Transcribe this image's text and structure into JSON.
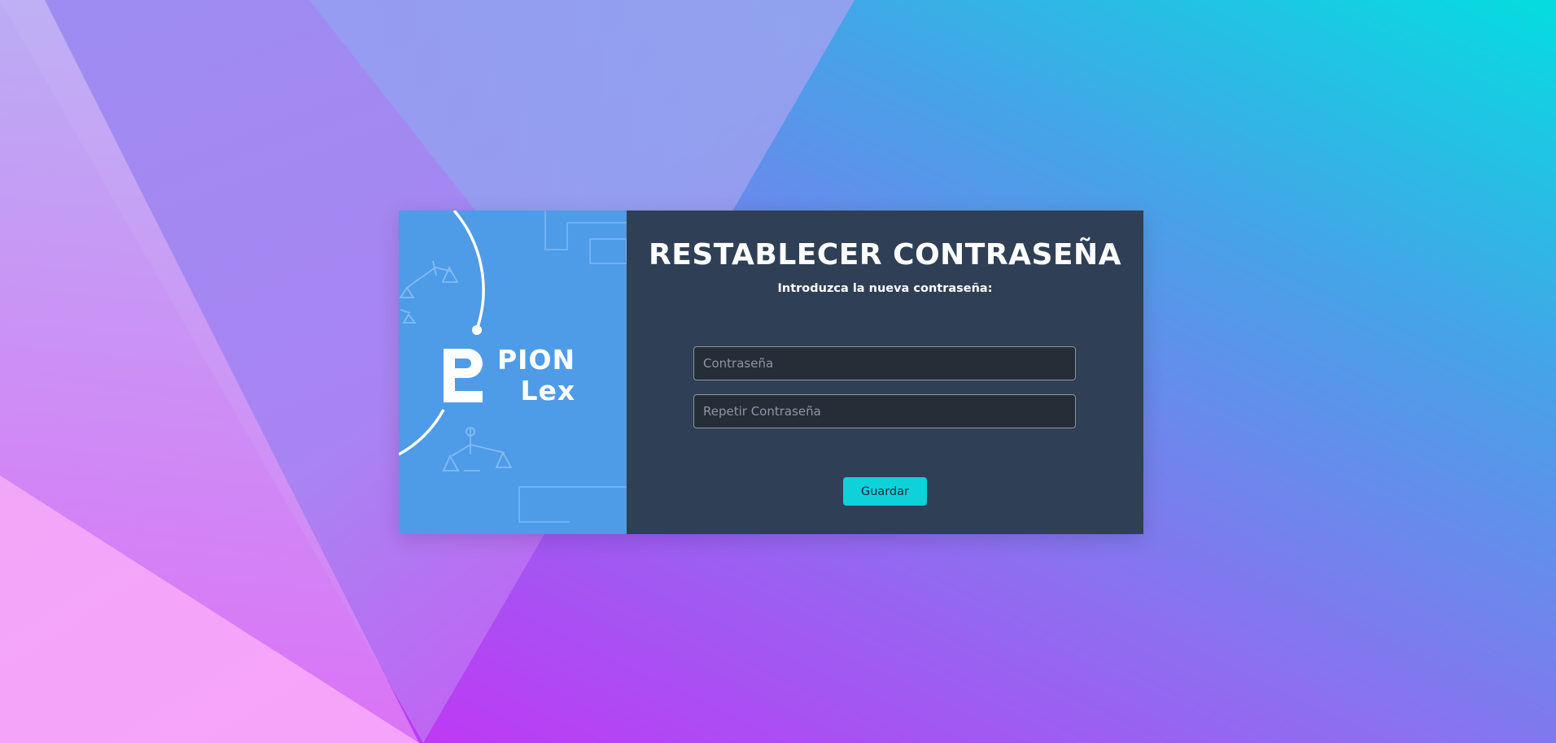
{
  "background": {
    "colors": {
      "top_left": "#b7a6f4",
      "top_right": "#07dbe0",
      "bottom_left": "#f5a4fb",
      "bottom_center": "#cf29f5",
      "bottom_right": "#7a6dea"
    }
  },
  "brand": {
    "logo_icon": "pionlex-logo-icon",
    "name_line1": "PION",
    "name_line2": "Lex",
    "panel_color": "#4e9be8",
    "decoration_icon": "scales-of-justice-icon"
  },
  "form": {
    "title": "RESTABLECER CONTRASEÑA",
    "subtitle": "Introduzca la nueva contraseña:",
    "password_placeholder": "Contraseña",
    "password_value": "",
    "repeat_password_placeholder": "Repetir Contraseña",
    "repeat_password_value": "",
    "save_label": "Guardar",
    "panel_color": "#2f3f55",
    "button_color": "#0fd1d9"
  }
}
